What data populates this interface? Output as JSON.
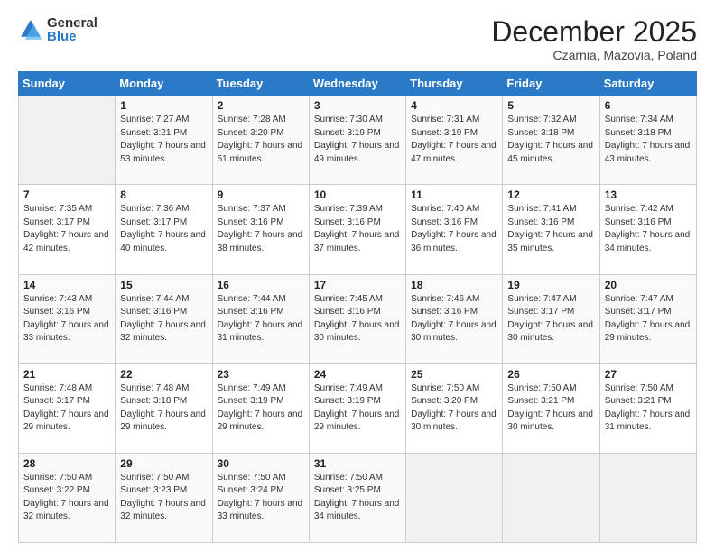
{
  "logo": {
    "general": "General",
    "blue": "Blue"
  },
  "header": {
    "title": "December 2025",
    "subtitle": "Czarnia, Mazovia, Poland"
  },
  "weekdays": [
    "Sunday",
    "Monday",
    "Tuesday",
    "Wednesday",
    "Thursday",
    "Friday",
    "Saturday"
  ],
  "weeks": [
    [
      {
        "day": "",
        "sunrise": "",
        "sunset": "",
        "daylight": "",
        "empty": true
      },
      {
        "day": "1",
        "sunrise": "Sunrise: 7:27 AM",
        "sunset": "Sunset: 3:21 PM",
        "daylight": "Daylight: 7 hours and 53 minutes."
      },
      {
        "day": "2",
        "sunrise": "Sunrise: 7:28 AM",
        "sunset": "Sunset: 3:20 PM",
        "daylight": "Daylight: 7 hours and 51 minutes."
      },
      {
        "day": "3",
        "sunrise": "Sunrise: 7:30 AM",
        "sunset": "Sunset: 3:19 PM",
        "daylight": "Daylight: 7 hours and 49 minutes."
      },
      {
        "day": "4",
        "sunrise": "Sunrise: 7:31 AM",
        "sunset": "Sunset: 3:19 PM",
        "daylight": "Daylight: 7 hours and 47 minutes."
      },
      {
        "day": "5",
        "sunrise": "Sunrise: 7:32 AM",
        "sunset": "Sunset: 3:18 PM",
        "daylight": "Daylight: 7 hours and 45 minutes."
      },
      {
        "day": "6",
        "sunrise": "Sunrise: 7:34 AM",
        "sunset": "Sunset: 3:18 PM",
        "daylight": "Daylight: 7 hours and 43 minutes."
      }
    ],
    [
      {
        "day": "7",
        "sunrise": "Sunrise: 7:35 AM",
        "sunset": "Sunset: 3:17 PM",
        "daylight": "Daylight: 7 hours and 42 minutes."
      },
      {
        "day": "8",
        "sunrise": "Sunrise: 7:36 AM",
        "sunset": "Sunset: 3:17 PM",
        "daylight": "Daylight: 7 hours and 40 minutes."
      },
      {
        "day": "9",
        "sunrise": "Sunrise: 7:37 AM",
        "sunset": "Sunset: 3:16 PM",
        "daylight": "Daylight: 7 hours and 38 minutes."
      },
      {
        "day": "10",
        "sunrise": "Sunrise: 7:39 AM",
        "sunset": "Sunset: 3:16 PM",
        "daylight": "Daylight: 7 hours and 37 minutes."
      },
      {
        "day": "11",
        "sunrise": "Sunrise: 7:40 AM",
        "sunset": "Sunset: 3:16 PM",
        "daylight": "Daylight: 7 hours and 36 minutes."
      },
      {
        "day": "12",
        "sunrise": "Sunrise: 7:41 AM",
        "sunset": "Sunset: 3:16 PM",
        "daylight": "Daylight: 7 hours and 35 minutes."
      },
      {
        "day": "13",
        "sunrise": "Sunrise: 7:42 AM",
        "sunset": "Sunset: 3:16 PM",
        "daylight": "Daylight: 7 hours and 34 minutes."
      }
    ],
    [
      {
        "day": "14",
        "sunrise": "Sunrise: 7:43 AM",
        "sunset": "Sunset: 3:16 PM",
        "daylight": "Daylight: 7 hours and 33 minutes."
      },
      {
        "day": "15",
        "sunrise": "Sunrise: 7:44 AM",
        "sunset": "Sunset: 3:16 PM",
        "daylight": "Daylight: 7 hours and 32 minutes."
      },
      {
        "day": "16",
        "sunrise": "Sunrise: 7:44 AM",
        "sunset": "Sunset: 3:16 PM",
        "daylight": "Daylight: 7 hours and 31 minutes."
      },
      {
        "day": "17",
        "sunrise": "Sunrise: 7:45 AM",
        "sunset": "Sunset: 3:16 PM",
        "daylight": "Daylight: 7 hours and 30 minutes."
      },
      {
        "day": "18",
        "sunrise": "Sunrise: 7:46 AM",
        "sunset": "Sunset: 3:16 PM",
        "daylight": "Daylight: 7 hours and 30 minutes."
      },
      {
        "day": "19",
        "sunrise": "Sunrise: 7:47 AM",
        "sunset": "Sunset: 3:17 PM",
        "daylight": "Daylight: 7 hours and 30 minutes."
      },
      {
        "day": "20",
        "sunrise": "Sunrise: 7:47 AM",
        "sunset": "Sunset: 3:17 PM",
        "daylight": "Daylight: 7 hours and 29 minutes."
      }
    ],
    [
      {
        "day": "21",
        "sunrise": "Sunrise: 7:48 AM",
        "sunset": "Sunset: 3:17 PM",
        "daylight": "Daylight: 7 hours and 29 minutes."
      },
      {
        "day": "22",
        "sunrise": "Sunrise: 7:48 AM",
        "sunset": "Sunset: 3:18 PM",
        "daylight": "Daylight: 7 hours and 29 minutes."
      },
      {
        "day": "23",
        "sunrise": "Sunrise: 7:49 AM",
        "sunset": "Sunset: 3:19 PM",
        "daylight": "Daylight: 7 hours and 29 minutes."
      },
      {
        "day": "24",
        "sunrise": "Sunrise: 7:49 AM",
        "sunset": "Sunset: 3:19 PM",
        "daylight": "Daylight: 7 hours and 29 minutes."
      },
      {
        "day": "25",
        "sunrise": "Sunrise: 7:50 AM",
        "sunset": "Sunset: 3:20 PM",
        "daylight": "Daylight: 7 hours and 30 minutes."
      },
      {
        "day": "26",
        "sunrise": "Sunrise: 7:50 AM",
        "sunset": "Sunset: 3:21 PM",
        "daylight": "Daylight: 7 hours and 30 minutes."
      },
      {
        "day": "27",
        "sunrise": "Sunrise: 7:50 AM",
        "sunset": "Sunset: 3:21 PM",
        "daylight": "Daylight: 7 hours and 31 minutes."
      }
    ],
    [
      {
        "day": "28",
        "sunrise": "Sunrise: 7:50 AM",
        "sunset": "Sunset: 3:22 PM",
        "daylight": "Daylight: 7 hours and 32 minutes."
      },
      {
        "day": "29",
        "sunrise": "Sunrise: 7:50 AM",
        "sunset": "Sunset: 3:23 PM",
        "daylight": "Daylight: 7 hours and 32 minutes."
      },
      {
        "day": "30",
        "sunrise": "Sunrise: 7:50 AM",
        "sunset": "Sunset: 3:24 PM",
        "daylight": "Daylight: 7 hours and 33 minutes."
      },
      {
        "day": "31",
        "sunrise": "Sunrise: 7:50 AM",
        "sunset": "Sunset: 3:25 PM",
        "daylight": "Daylight: 7 hours and 34 minutes."
      },
      {
        "day": "",
        "sunrise": "",
        "sunset": "",
        "daylight": "",
        "empty": true
      },
      {
        "day": "",
        "sunrise": "",
        "sunset": "",
        "daylight": "",
        "empty": true
      },
      {
        "day": "",
        "sunrise": "",
        "sunset": "",
        "daylight": "",
        "empty": true
      }
    ]
  ]
}
